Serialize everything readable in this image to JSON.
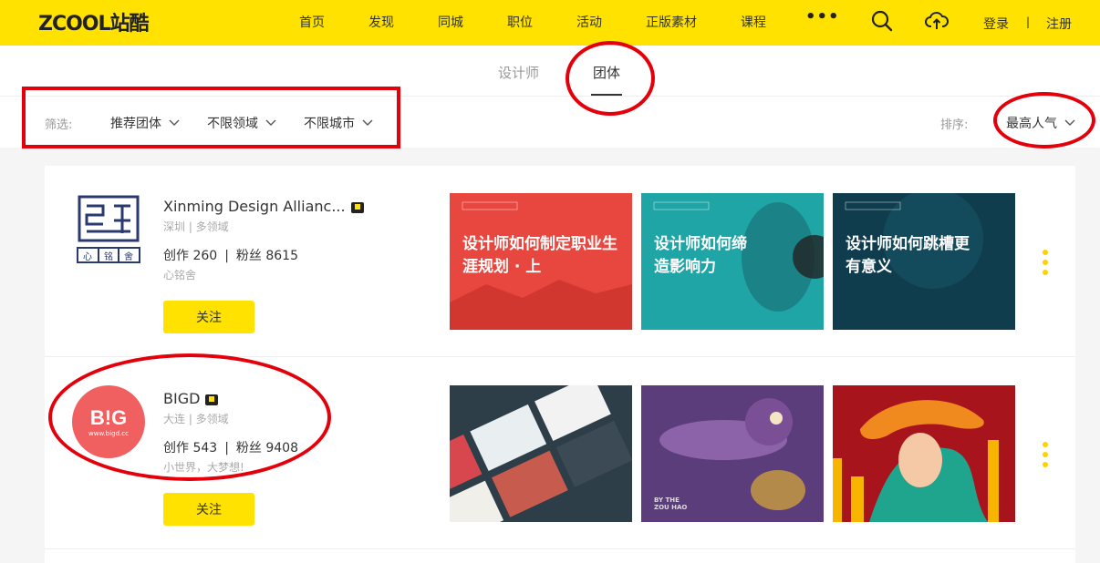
{
  "header": {
    "logo": "ZCOOL站酷",
    "nav": [
      "首页",
      "发现",
      "同城",
      "职位",
      "活动",
      "正版素材",
      "课程"
    ],
    "more": "•••",
    "login": "登录",
    "divider": "|",
    "register": "注册",
    "brand_color": "#ffe200"
  },
  "tabs": [
    {
      "label": "设计师"
    },
    {
      "label": "团体"
    }
  ],
  "filters": {
    "label": "筛选:",
    "dropdowns": [
      "推荐团体",
      "不限领域",
      "不限城市"
    ],
    "sort_label": "排序:",
    "sort_value": "最高人气"
  },
  "teams": [
    {
      "name": "Xinming Design Allianc...",
      "location": "深圳 | 多领域",
      "works_label": "创作",
      "works": "260",
      "fans_label": "粉丝",
      "fans": "8615",
      "slogan": "心铭舍",
      "follow": "关注",
      "logo_text": "心|铭|舍",
      "thumbs": [
        {
          "title": "设计师如何制定职业生涯规划 · 上",
          "color": "#e8473f"
        },
        {
          "title": "设计师如何缔造影响力",
          "color": "#1fa5a5"
        },
        {
          "title": "设计师如何跳槽更有意义",
          "color": "#0f3d4e"
        }
      ]
    },
    {
      "name": "BIGD",
      "location": "大连 | 多领域",
      "works_label": "创作",
      "works": "543",
      "fans_label": "粉丝",
      "fans": "9408",
      "slogan": "小世界，大梦想!",
      "follow": "关注",
      "logo_text": "B!G",
      "logo_sub": "www.bigd.cc",
      "thumbs": [
        {
          "title": "",
          "color": "#2d3e48"
        },
        {
          "title": "BY THE ZOU HAO",
          "color": "#5a3d7a"
        },
        {
          "title": "",
          "color": "#a8141b"
        }
      ]
    }
  ],
  "annotation_color": "#e3000b"
}
